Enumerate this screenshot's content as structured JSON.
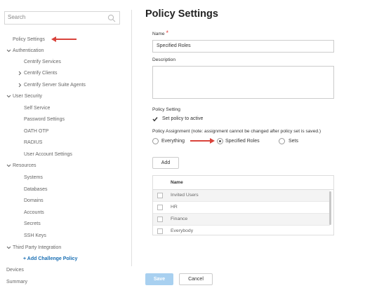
{
  "search": {
    "placeholder": "Search"
  },
  "sidebar": {
    "items": [
      {
        "label": "Policy Settings",
        "level": 1
      },
      {
        "label": "Authentication",
        "level": 0,
        "expanded": true
      },
      {
        "label": "Centrify Services",
        "level": 2
      },
      {
        "label": "Centrify Clients",
        "level": 2,
        "collapsed": true
      },
      {
        "label": "Centrify Server Suite Agents",
        "level": 2,
        "collapsed": true
      },
      {
        "label": "User Security",
        "level": 0,
        "expanded": true
      },
      {
        "label": "Self Service",
        "level": 2
      },
      {
        "label": "Password Settings",
        "level": 2
      },
      {
        "label": "OATH OTP",
        "level": 2
      },
      {
        "label": "RADIUS",
        "level": 2
      },
      {
        "label": "User Account Settings",
        "level": 2
      },
      {
        "label": "Resources",
        "level": 0,
        "expanded": true
      },
      {
        "label": "Systems",
        "level": 2
      },
      {
        "label": "Databases",
        "level": 2
      },
      {
        "label": "Domains",
        "level": 2
      },
      {
        "label": "Accounts",
        "level": 2
      },
      {
        "label": "Secrets",
        "level": 2
      },
      {
        "label": "SSH Keys",
        "level": 2
      },
      {
        "label": "Third Party Integration",
        "level": 0,
        "expanded": true
      },
      {
        "label": "+ Add Challenge Policy",
        "level": 2,
        "accent": true
      },
      {
        "label": "Devices",
        "level": 0
      },
      {
        "label": "Summary",
        "level": 0
      }
    ]
  },
  "main": {
    "title": "Policy Settings",
    "name_label": "Name",
    "required_mark": "*",
    "name_value": "Specified Roles",
    "description_label": "Description",
    "description_value": "",
    "policy_setting_label": "Policy Setting",
    "set_active_label": "Set policy to active",
    "set_active_checked": true,
    "assignment_label": "Policy Assignment (note: assignment cannot be changed after policy set is saved.)",
    "assignment_options": [
      {
        "label": "Everything",
        "selected": false
      },
      {
        "label": "Specified Roles",
        "selected": true
      },
      {
        "label": "Sets",
        "selected": false
      }
    ],
    "add_label": "Add",
    "table": {
      "header": "Name",
      "rows": [
        "Invited Users",
        "HR",
        "Finance",
        "Everybody"
      ]
    },
    "save_label": "Save",
    "cancel_label": "Cancel"
  },
  "colors": {
    "accent": "#1a6fb4",
    "annotation_arrow": "#d9433b",
    "save_button": "#a8d0f0"
  }
}
